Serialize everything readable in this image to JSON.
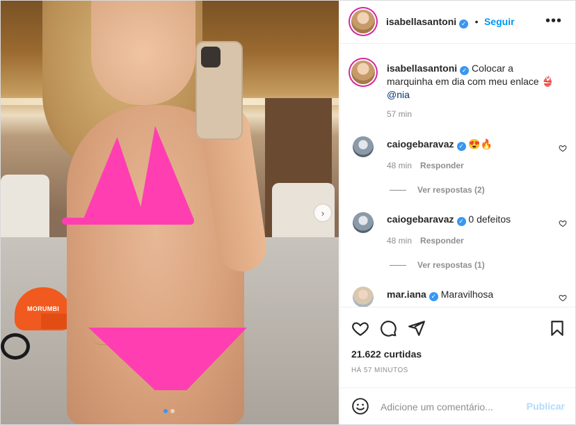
{
  "post": {
    "photo_cap_text": "MORUMBI",
    "carousel": {
      "count": 2,
      "active": 1
    },
    "icons": {
      "next": "chevron-right-icon"
    }
  },
  "header": {
    "username": "isabellasantoni",
    "separator": "•",
    "follow_label": "Seguir",
    "more_icon": "more-horizontal-icon"
  },
  "caption": {
    "username": "isabellasantoni",
    "text": "Colocar a marquinha em dia com meu enlace 👙",
    "mention": "@nia",
    "time": "57 min"
  },
  "comments": [
    {
      "username": "caiogebaravaz",
      "text": "😍🔥",
      "time": "48 min",
      "reply_label": "Responder",
      "view_replies": "Ver respostas (2)"
    },
    {
      "username": "caiogebaravaz",
      "text": "0 defeitos",
      "time": "48 min",
      "reply_label": "Responder",
      "view_replies": "Ver respostas (1)"
    },
    {
      "username": "mar.iana",
      "text": "Maravilhosa"
    }
  ],
  "actions": {
    "icons": [
      "heart-icon",
      "comment-icon",
      "share-icon",
      "bookmark-icon"
    ],
    "likes": "21.622 curtidas",
    "timestamp": "HÁ 57 MINUTOS"
  },
  "comment_box": {
    "placeholder": "Adicione um comentário...",
    "publish_label": "Publicar",
    "emoji_icon": "emoji-icon"
  },
  "colors": {
    "accent": "#0095f6",
    "verified": "#3897f0",
    "publish_disabled": "#b3dbff"
  }
}
